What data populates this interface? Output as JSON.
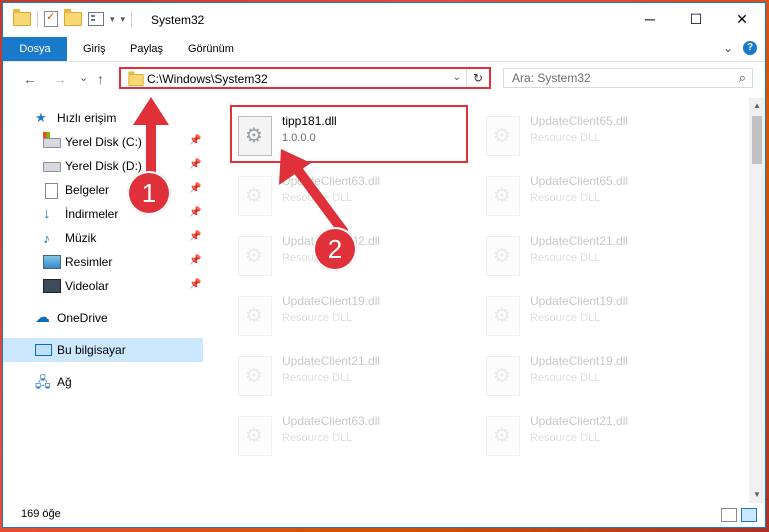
{
  "titlebar": {
    "title": "System32",
    "minimize": "─",
    "maximize": "☐",
    "close": "✕"
  },
  "ribbon": {
    "tabs": [
      {
        "label": "Dosya",
        "active": true
      },
      {
        "label": "Giriş"
      },
      {
        "label": "Paylaş"
      },
      {
        "label": "Görünüm"
      }
    ],
    "expand": "⌄",
    "help": "?"
  },
  "nav": {
    "back": "←",
    "forward": "→",
    "recent": "⌄",
    "up": "↑",
    "address": "C:\\Windows\\System32",
    "address_drop": "⌄",
    "refresh": "↻",
    "search_placeholder": "Ara: System32",
    "search_icon": "⌕"
  },
  "sidebar": {
    "items": [
      {
        "label": "Hızlı erişim",
        "icon": "star-icon"
      },
      {
        "label": "Yerel Disk (C:)",
        "icon": "disk-icon",
        "pinned": true
      },
      {
        "label": "Yerel Disk (D:)",
        "icon": "disk-icon",
        "pinned": true
      },
      {
        "label": "Belgeler",
        "icon": "documents-icon",
        "pinned": true
      },
      {
        "label": "İndirmeler",
        "icon": "download-icon",
        "pinned": true
      },
      {
        "label": "Müzik",
        "icon": "music-icon",
        "pinned": true
      },
      {
        "label": "Resimler",
        "icon": "pictures-icon",
        "pinned": true
      },
      {
        "label": "Videolar",
        "icon": "videos-icon",
        "pinned": true
      },
      {
        "label": "OneDrive",
        "icon": "cloud-icon"
      },
      {
        "label": "Bu bilgisayar",
        "icon": "computer-icon",
        "selected": true
      },
      {
        "label": "Ağ",
        "icon": "network-icon"
      }
    ],
    "pin_glyph": "📌"
  },
  "files": [
    {
      "name": "tipp181.dll",
      "desc": "1.0.0.0",
      "highlighted": true
    },
    {
      "name": "UpdateClient65.dll",
      "desc": "Resource DLL"
    },
    {
      "name": "UpdateClient63.dll",
      "desc": "Resource DLL"
    },
    {
      "name": "UpdateClient65.dll",
      "desc": "Resource DLL"
    },
    {
      "name": "UpdateClient42.dll",
      "desc": "Resource DLL"
    },
    {
      "name": "UpdateClient21.dll",
      "desc": "Resource DLL"
    },
    {
      "name": "UpdateClient19.dll",
      "desc": "Resource DLL"
    },
    {
      "name": "UpdateClient19.dll",
      "desc": "Resource DLL"
    },
    {
      "name": "UpdateClient21.dll",
      "desc": "Resource DLL"
    },
    {
      "name": "UpdateClient19.dll",
      "desc": "Resource DLL"
    },
    {
      "name": "UpdateClient63.dll",
      "desc": "Resource DLL"
    },
    {
      "name": "UpdateClient21.dll",
      "desc": "Resource DLL"
    }
  ],
  "status": {
    "count": "169 öğe"
  },
  "annotations": {
    "step1": "1",
    "step2": "2",
    "color": "#e0303a"
  }
}
